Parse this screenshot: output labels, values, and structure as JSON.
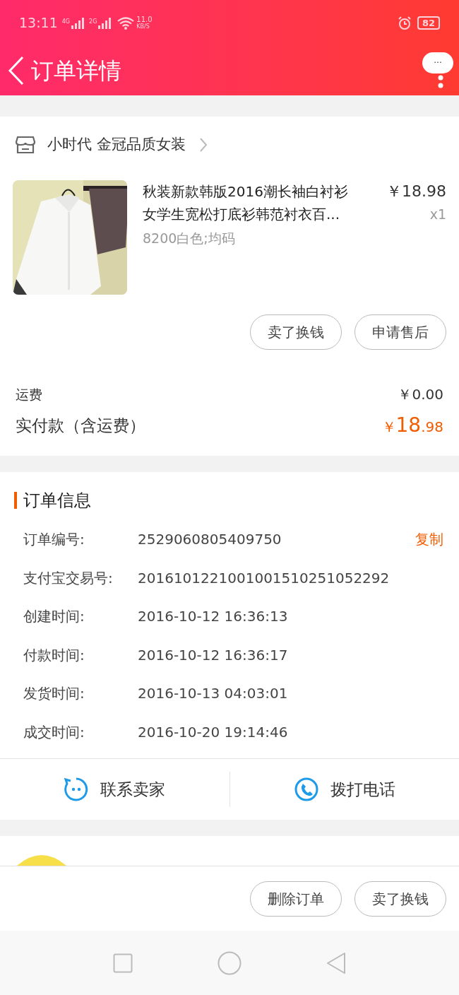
{
  "status_bar": {
    "time": "13:11",
    "networks": [
      "4G",
      "2G"
    ],
    "speed_value": "11.0",
    "speed_unit": "KB/S",
    "battery": "82"
  },
  "header": {
    "title": "订单详情",
    "menu": "···"
  },
  "shop": {
    "name": "小时代 金冠品质女装"
  },
  "item": {
    "title_lines": [
      "秋装新款韩版2016潮长袖白衬衫",
      "女学生宽松打底衫韩范衬衣百..."
    ],
    "price": "￥18.98",
    "quantity": "x1",
    "sku": "8200白色;均码",
    "buttons": [
      "卖了换钱",
      "申请售后"
    ]
  },
  "fees": {
    "shipping_label": "运费",
    "shipping_value": "￥0.00",
    "total_label": "实付款（含运费）",
    "total_currency": "￥",
    "total_integer": "18",
    "total_decimal": ".98"
  },
  "order_info": {
    "title": "订单信息",
    "rows": [
      {
        "label": "订单编号:",
        "value": "2529060805409750",
        "action": "复制"
      },
      {
        "label": "支付宝交易号:",
        "value": "2016101221001001510251052292"
      },
      {
        "label": "创建时间:",
        "value": "2016-10-12 16:36:13"
      },
      {
        "label": "付款时间:",
        "value": "2016-10-12 16:36:17"
      },
      {
        "label": "发货时间:",
        "value": "2016-10-13 04:03:01"
      },
      {
        "label": "成交时间:",
        "value": "2016-10-20 19:14:46"
      }
    ]
  },
  "contact": [
    {
      "kind": "chat",
      "label": "联系卖家"
    },
    {
      "kind": "phone",
      "label": "拨打电话"
    }
  ],
  "bottom_buttons": [
    "删除订单",
    "卖了换钱"
  ]
}
